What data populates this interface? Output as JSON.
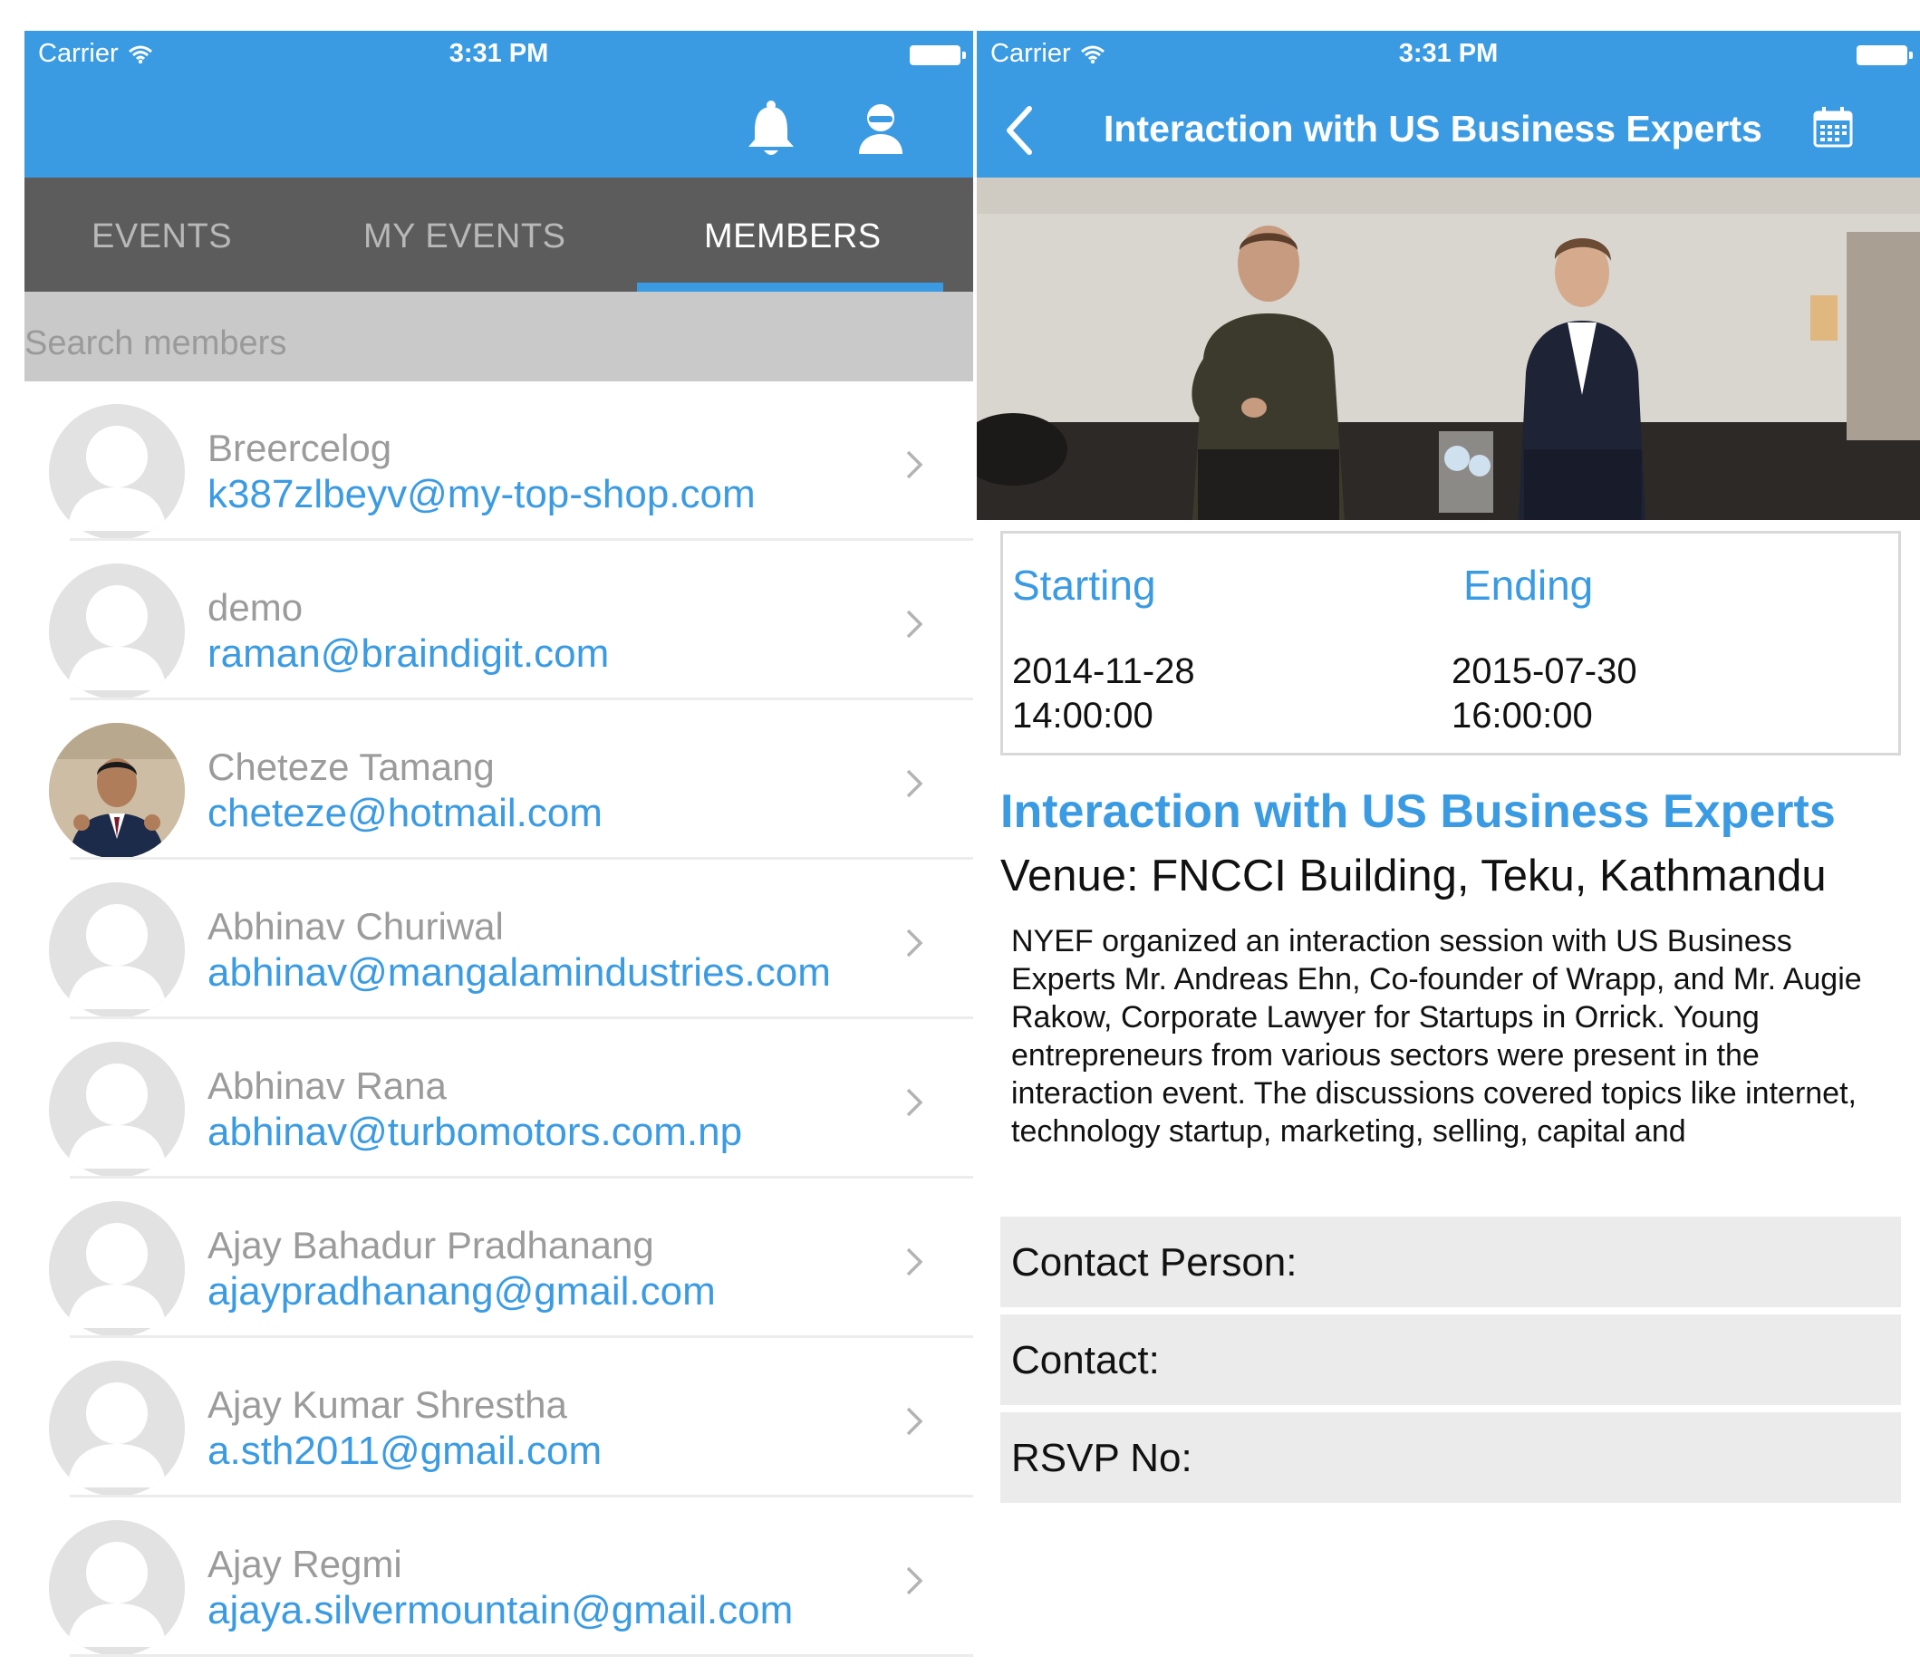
{
  "members_screen": {
    "status": {
      "carrier": "Carrier",
      "time": "3:31 PM"
    },
    "tabs": [
      {
        "label": "EVENTS"
      },
      {
        "label": "MY EVENTS"
      },
      {
        "label": "MEMBERS"
      }
    ],
    "active_tab": "MEMBERS",
    "search": {
      "placeholder": "Search members"
    },
    "members": [
      {
        "name": "Breercelog",
        "email": "k387zlbeyv@my-top-shop.com",
        "avatar": "default-avatar"
      },
      {
        "name": "demo",
        "email": "raman@braindigit.com",
        "avatar": "default-avatar"
      },
      {
        "name": "Cheteze Tamang",
        "email": "cheteze@hotmail.com",
        "avatar": "photo-avatar"
      },
      {
        "name": "Abhinav Churiwal",
        "email": "abhinav@mangalamindustries.com",
        "avatar": "default-avatar"
      },
      {
        "name": "Abhinav Rana",
        "email": "abhinav@turbomotors.com.np",
        "avatar": "default-avatar"
      },
      {
        "name": "Ajay Bahadur Pradhanang",
        "email": "ajaypradhanang@gmail.com",
        "avatar": "default-avatar"
      },
      {
        "name": "Ajay Kumar Shrestha",
        "email": "a.sth2011@gmail.com",
        "avatar": "default-avatar"
      },
      {
        "name": "Ajay Regmi",
        "email": "ajaya.silvermountain@gmail.com",
        "avatar": "default-avatar"
      }
    ],
    "icons": [
      "bell-icon",
      "profile-icon",
      "chevron-right-icon"
    ]
  },
  "event_screen": {
    "status": {
      "carrier": "Carrier",
      "time": "3:31 PM"
    },
    "title": "Interaction with US Business Experts",
    "starting": {
      "label": "Starting",
      "date": "2014-11-28",
      "time": "14:00:00"
    },
    "ending": {
      "label": "Ending",
      "date": "2015-07-30",
      "time": "16:00:00"
    },
    "event_name": "Interaction with US Business Experts",
    "venue": "Venue: FNCCI Building, Teku, Kathmandu",
    "description": "NYEF organized an interaction session with US Business Experts Mr. Andreas Ehn, Co-founder of Wrapp, and Mr. Augie Rakow, Corporate Lawyer for Startups in Orrick. Young entrepreneurs from various sectors were present in the interaction event. The discussions covered topics like internet, technology startup, marketing, selling, capital and",
    "contact_person_label": "Contact Person:",
    "contact_label": "Contact:",
    "rsvp_label": "RSVP No:",
    "icons": [
      "back-icon",
      "calendar-icon"
    ]
  },
  "colors": {
    "accent": "#3a9be3",
    "tab_bar": "#5c5c5c",
    "search_bar": "#c9c9c9",
    "member_name": "#9b9b9b"
  }
}
